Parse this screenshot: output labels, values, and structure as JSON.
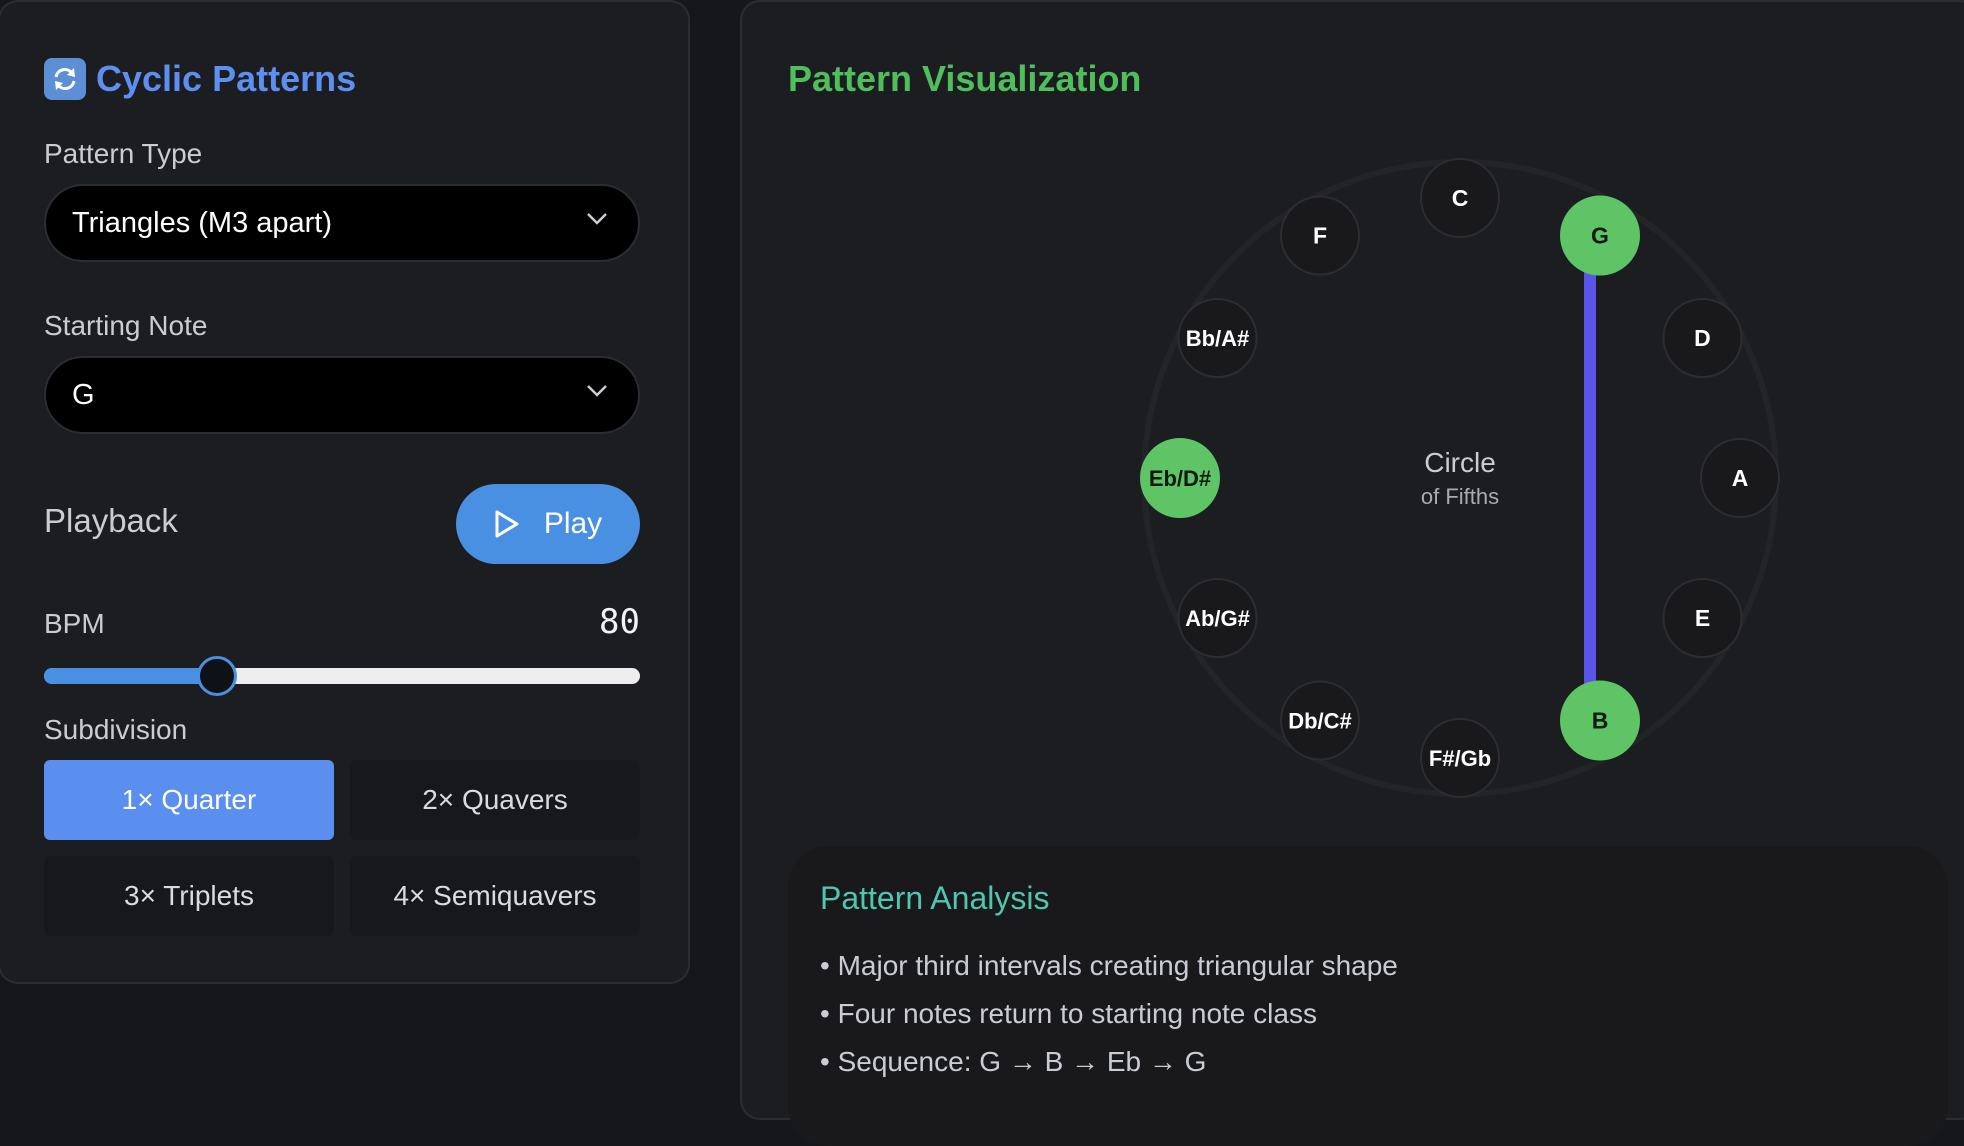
{
  "sidebar": {
    "title": "Cyclic Patterns",
    "icon": "cycle-arrows-icon",
    "pattern_type": {
      "label": "Pattern Type",
      "value": "Triangles (M3 apart)"
    },
    "starting_note": {
      "label": "Starting Note",
      "value": "G"
    },
    "playback": {
      "label": "Playback",
      "play_label": "Play"
    },
    "bpm": {
      "label": "BPM",
      "value": "80",
      "slider_fraction": 0.29
    },
    "subdivision": {
      "label": "Subdivision",
      "options": [
        {
          "label": "1× Quarter",
          "active": true
        },
        {
          "label": "2× Quavers",
          "active": false
        },
        {
          "label": "3× Triplets",
          "active": false
        },
        {
          "label": "4× Semiquavers",
          "active": false
        }
      ]
    }
  },
  "visualization": {
    "title": "Pattern Visualization",
    "center_line1": "Circle",
    "center_line2": "of Fifths",
    "notes": [
      "C",
      "G",
      "D",
      "A",
      "E",
      "B",
      "F#/Gb",
      "Db/C#",
      "Ab/G#",
      "Eb/D#",
      "Bb/A#",
      "F"
    ],
    "highlighted": [
      "G",
      "B",
      "Eb/D#"
    ],
    "colors": {
      "highlight": "#5ec466",
      "line": "#5a55e6",
      "node": "#19191c"
    }
  },
  "analysis": {
    "title": "Pattern Analysis",
    "items": [
      "Major third intervals creating triangular shape",
      "Four notes return to starting note class",
      "Sequence: G → B → Eb → G"
    ]
  }
}
